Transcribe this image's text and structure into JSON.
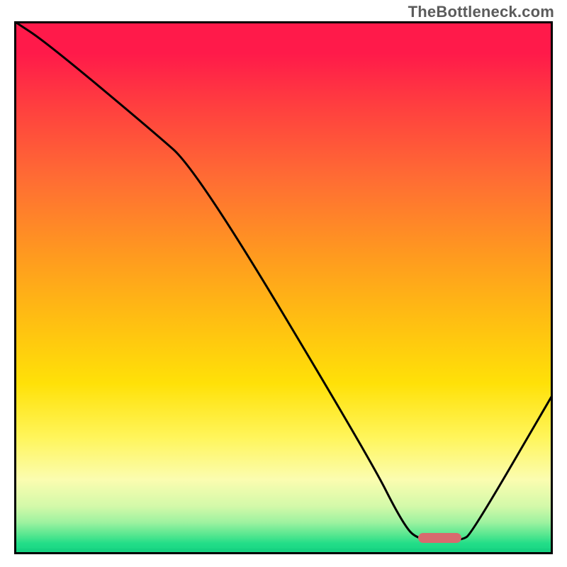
{
  "watermark": "TheBottleneck.com",
  "colors": {
    "curve": "#000000",
    "marker": "#d86a6e",
    "border": "#000000"
  },
  "chart_data": {
    "type": "line",
    "title": "",
    "xlabel": "",
    "ylabel": "",
    "xlim": [
      0,
      100
    ],
    "ylim": [
      0,
      100
    ],
    "background_gradient": "red-to-green-vertical",
    "annotations": [
      {
        "type": "marker-bar",
        "x": 79,
        "y": 3,
        "width_pct": 8,
        "color": "#d86a6e"
      }
    ],
    "series": [
      {
        "name": "bottleneck-curve",
        "x": [
          0,
          6,
          25,
          34,
          66,
          72,
          75,
          83,
          85,
          100
        ],
        "values": [
          100,
          96,
          80,
          72,
          18,
          6,
          2.5,
          2.5,
          4,
          30
        ]
      }
    ]
  }
}
